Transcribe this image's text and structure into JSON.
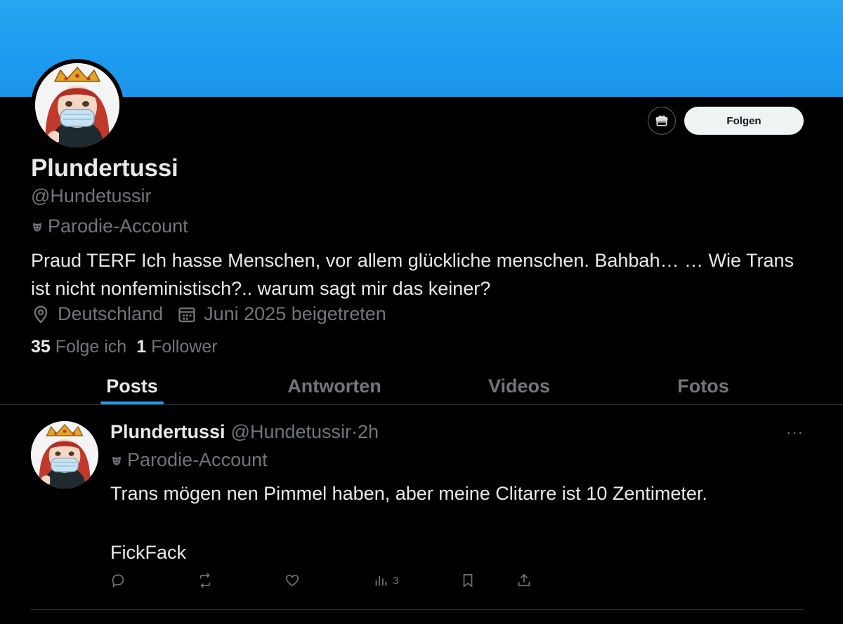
{
  "profile": {
    "display_name": "Plundertussi",
    "handle": "@Hundetussir",
    "label": "Parodie-Account",
    "bio": "Praud TERF Ich hasse Menschen, vor allem glückliche menschen. Bahbah… … Wie Trans ist nicht nonfeministisch?.. warum sagt mir das keiner?",
    "location": "Deutschland",
    "joined": "Juni 2025 beigetreten",
    "following_count": "35",
    "following_label": "Folge ich",
    "followers_count": "1",
    "followers_label": "Follower"
  },
  "actions": {
    "follow_label": "Folgen",
    "gift_icon": "gift-icon"
  },
  "tabs": [
    {
      "label": "Posts",
      "active": true
    },
    {
      "label": "Antworten",
      "active": false
    },
    {
      "label": "Videos",
      "active": false
    },
    {
      "label": "Fotos",
      "active": false
    }
  ],
  "post": {
    "name": "Plundertussi",
    "handle": "@Hundetussir",
    "separator": "·",
    "time": "2h",
    "label": "Parodie-Account",
    "text": "Trans mögen nen Pimmel haben, aber meine Clitarre ist 10 Zentimeter.\n\nFickFack",
    "more": "···",
    "views": "3"
  },
  "colors": {
    "accent": "#1d9bf0",
    "banner": "#1d9bf0",
    "background": "#000000",
    "text_primary": "#e7e9ea",
    "text_secondary": "#71767b",
    "border": "#2f3336"
  }
}
